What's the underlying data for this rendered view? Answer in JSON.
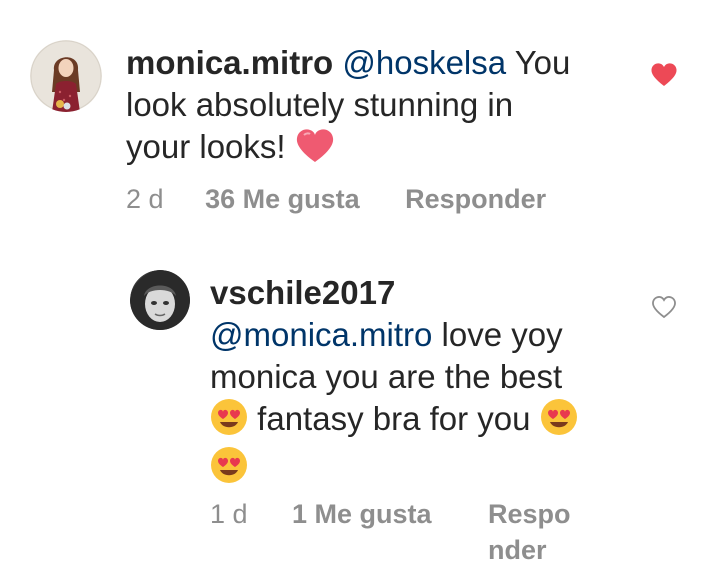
{
  "comments": [
    {
      "username": "monica.mitro",
      "mention": "@hoskelsa",
      "text_line1_rest": " You",
      "text_line2": "look absolutely stunning in",
      "text_line3": "your looks! ",
      "emoji": "heart",
      "time": "2 d",
      "likes": "36 Me gusta",
      "reply": "Responder",
      "liked": true,
      "like_color": "#ed4956",
      "avatar_icon": "illustrated-woman-avatar"
    },
    {
      "username": "vschile2017",
      "mention": "@monica.mitro",
      "text_line1_rest": " love yoy",
      "text_line2": "monica  you are the best",
      "text_line3": " fantasy bra for you ",
      "emoji": "heart-eyes",
      "time": "1 d",
      "likes": "1 Me gusta",
      "reply_part1": "Respo",
      "reply_part2": "nder",
      "liked": false,
      "avatar_icon": "grayscale-photo-avatar"
    }
  ]
}
